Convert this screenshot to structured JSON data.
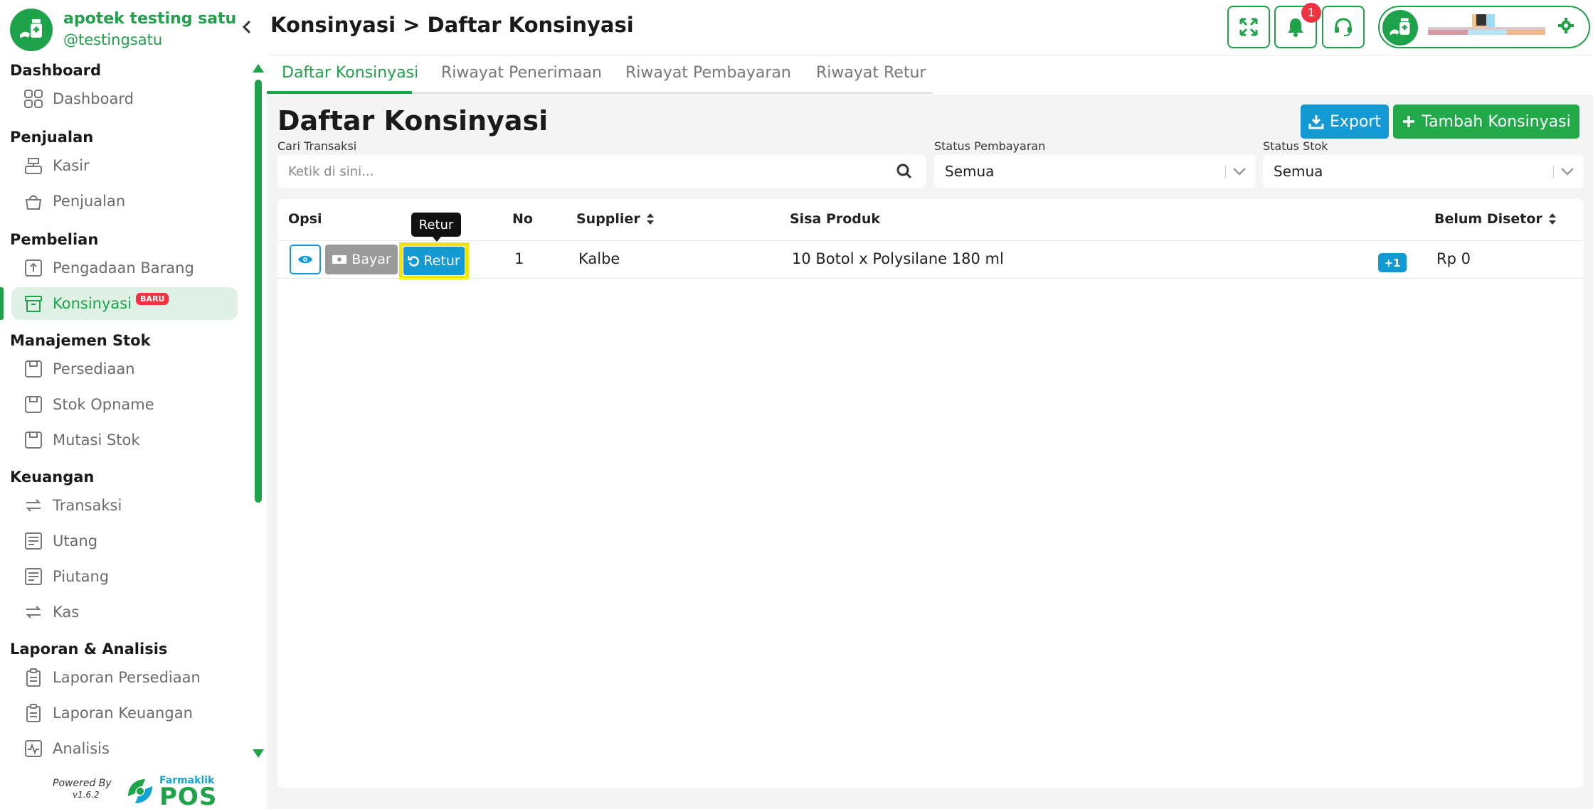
{
  "store": {
    "name": "apotek testing satu",
    "handle": "@testingsatu"
  },
  "sidebar": {
    "sections": [
      {
        "title": "Dashboard",
        "items": [
          {
            "label": "Dashboard",
            "icon": "grid-icon"
          }
        ]
      },
      {
        "title": "Penjualan",
        "items": [
          {
            "label": "Kasir",
            "icon": "cash-register-icon"
          },
          {
            "label": "Penjualan",
            "icon": "shopping-basket-icon"
          }
        ]
      },
      {
        "title": "Pembelian",
        "items": [
          {
            "label": "Pengadaan Barang",
            "icon": "inbox-upload-icon"
          },
          {
            "label": "Konsinyasi",
            "icon": "archive-box-icon",
            "badge": "BARU",
            "active": true
          }
        ]
      },
      {
        "title": "Manajemen Stok",
        "items": [
          {
            "label": "Persediaan",
            "icon": "stock-box-icon"
          },
          {
            "label": "Stok Opname",
            "icon": "stock-box-icon"
          },
          {
            "label": "Mutasi Stok",
            "icon": "stock-box-icon"
          }
        ]
      },
      {
        "title": "Keuangan",
        "items": [
          {
            "label": "Transaksi",
            "icon": "transfer-arrows-icon"
          },
          {
            "label": "Utang",
            "icon": "ledger-icon"
          },
          {
            "label": "Piutang",
            "icon": "ledger-icon"
          },
          {
            "label": "Kas",
            "icon": "transfer-arrows-icon"
          }
        ]
      },
      {
        "title": "Laporan & Analisis",
        "items": [
          {
            "label": "Laporan Persediaan",
            "icon": "clipboard-icon"
          },
          {
            "label": "Laporan Keuangan",
            "icon": "clipboard-icon"
          },
          {
            "label": "Analisis",
            "icon": "activity-chart-icon"
          }
        ]
      }
    ],
    "powered_by": "Powered By",
    "version": "v1.6.2",
    "brand_small": "Farmaklik",
    "brand_big": "POS"
  },
  "header": {
    "breadcrumb": "Konsinyasi > Daftar Konsinyasi",
    "notification_count": "1"
  },
  "tabs": [
    "Daftar Konsinyasi",
    "Riwayat Penerimaan",
    "Riwayat Pembayaran",
    "Riwayat Retur"
  ],
  "active_tab": 0,
  "main": {
    "title": "Daftar Konsinyasi",
    "export_label": "Export",
    "add_label": "Tambah Konsinyasi"
  },
  "filters": {
    "search_label": "Cari Transaksi",
    "search_placeholder": "Ketik di sini...",
    "payment_label": "Status Pembayaran",
    "payment_value": "Semua",
    "stock_label": "Status Stok",
    "stock_value": "Semua"
  },
  "table": {
    "headers": {
      "opsi": "Opsi",
      "no": "No",
      "supplier": "Supplier",
      "sisa": "Sisa Produk",
      "belum": "Belum Disetor"
    },
    "tooltip": "Retur",
    "rows": [
      {
        "bayar": "Bayar",
        "retur": "Retur",
        "no": "1",
        "supplier": "Kalbe",
        "sisa": "10 Botol x Polysilane 180 ml",
        "extra": "+1",
        "belum": "Rp 0"
      }
    ]
  },
  "colors": {
    "brand_green": "#1ea24a",
    "accent_blue": "#1399d4",
    "danger_red": "#ef3340",
    "highlight_yellow": "#f2e600"
  }
}
